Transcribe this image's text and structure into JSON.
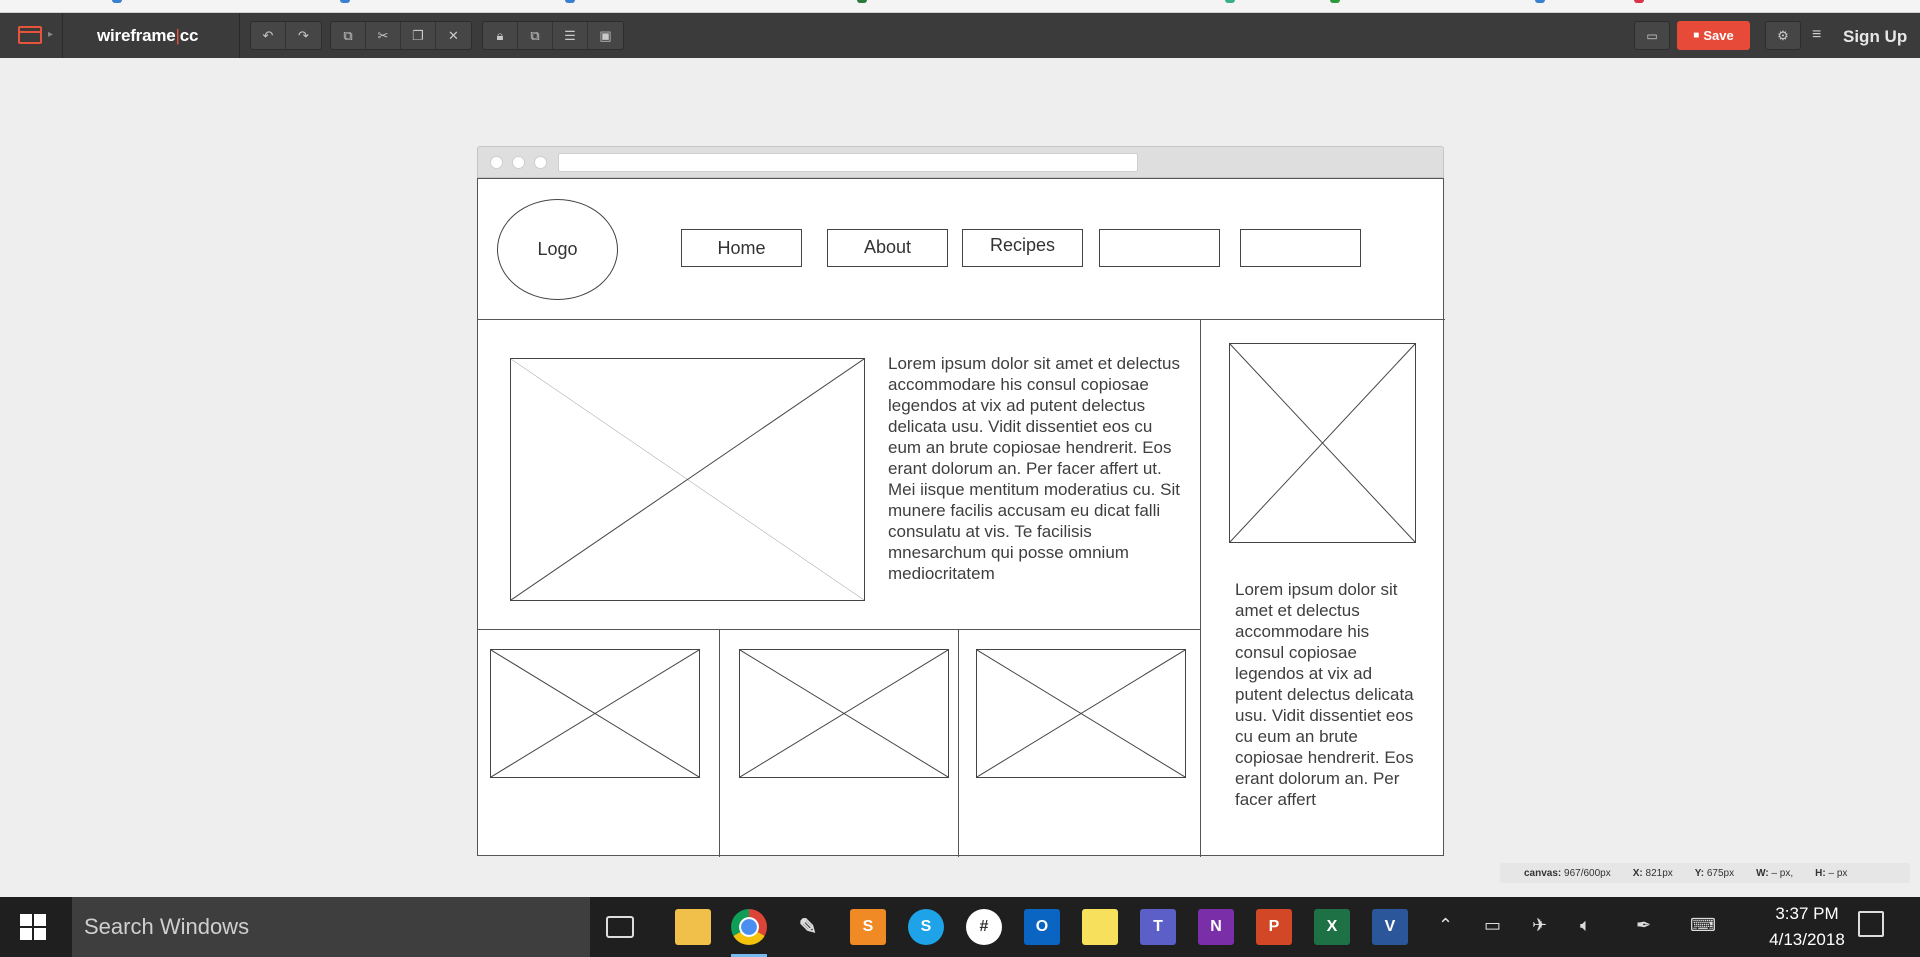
{
  "toolbar": {
    "brand_left": "wireframe",
    "brand_sep": "|",
    "brand_right": "cc",
    "save_label": "Save",
    "signup_label": "Sign Up",
    "icons": {
      "undo": "undo-icon",
      "redo": "redo-icon",
      "copy": "copy-icon",
      "cut": "cut-icon",
      "paste": "paste-icon",
      "delete": "delete-icon",
      "lock": "lock-icon",
      "arrange": "arrange-icon",
      "align": "align-icon",
      "group": "group-icon",
      "comment": "comment-icon",
      "settings": "settings-icon",
      "menu": "menu-icon"
    },
    "accent_color": "#e84a3a"
  },
  "wireframe": {
    "logo_text": "Logo",
    "nav": [
      "Home",
      "About",
      "Recipes",
      "",
      ""
    ],
    "main_text": "Lorem ipsum dolor sit amet et delectus accommodare his consul copiosae legendos at vix ad putent delectus delicata usu. Vidit dissentiet eos cu eum an brute copiosae hendrerit. Eos erant dolorum an. Per facer affert ut. Mei iisque mentitum moderatius cu. Sit munere facilis accusam eu dicat falli consulatu at vis. Te facilisis mnesarchum qui posse omnium mediocritatem",
    "side_text": "Lorem ipsum dolor sit amet et delectus accommodare his consul copiosae legendos at vix ad putent delectus delicata usu. Vidit dissentiet eos cu eum an brute copiosae hendrerit. Eos erant dolorum an. Per facer affert"
  },
  "status": {
    "canvas_label": "canvas:",
    "canvas_value": "967/600px",
    "x_label": "X:",
    "x_value": "821px",
    "y_label": "Y:",
    "y_value": "675px",
    "w_label": "W:",
    "w_value": "– px,",
    "h_label": "H:",
    "h_value": "– px"
  },
  "taskbar": {
    "search_placeholder": "Search Windows",
    "time": "3:37 PM",
    "date": "4/13/2018",
    "apps": [
      "task-view",
      "file-explorer",
      "chrome",
      "paint",
      "sublime-text",
      "skype",
      "slack",
      "outlook",
      "sticky-notes",
      "teams",
      "onenote",
      "powerpoint",
      "excel",
      "visio"
    ]
  }
}
